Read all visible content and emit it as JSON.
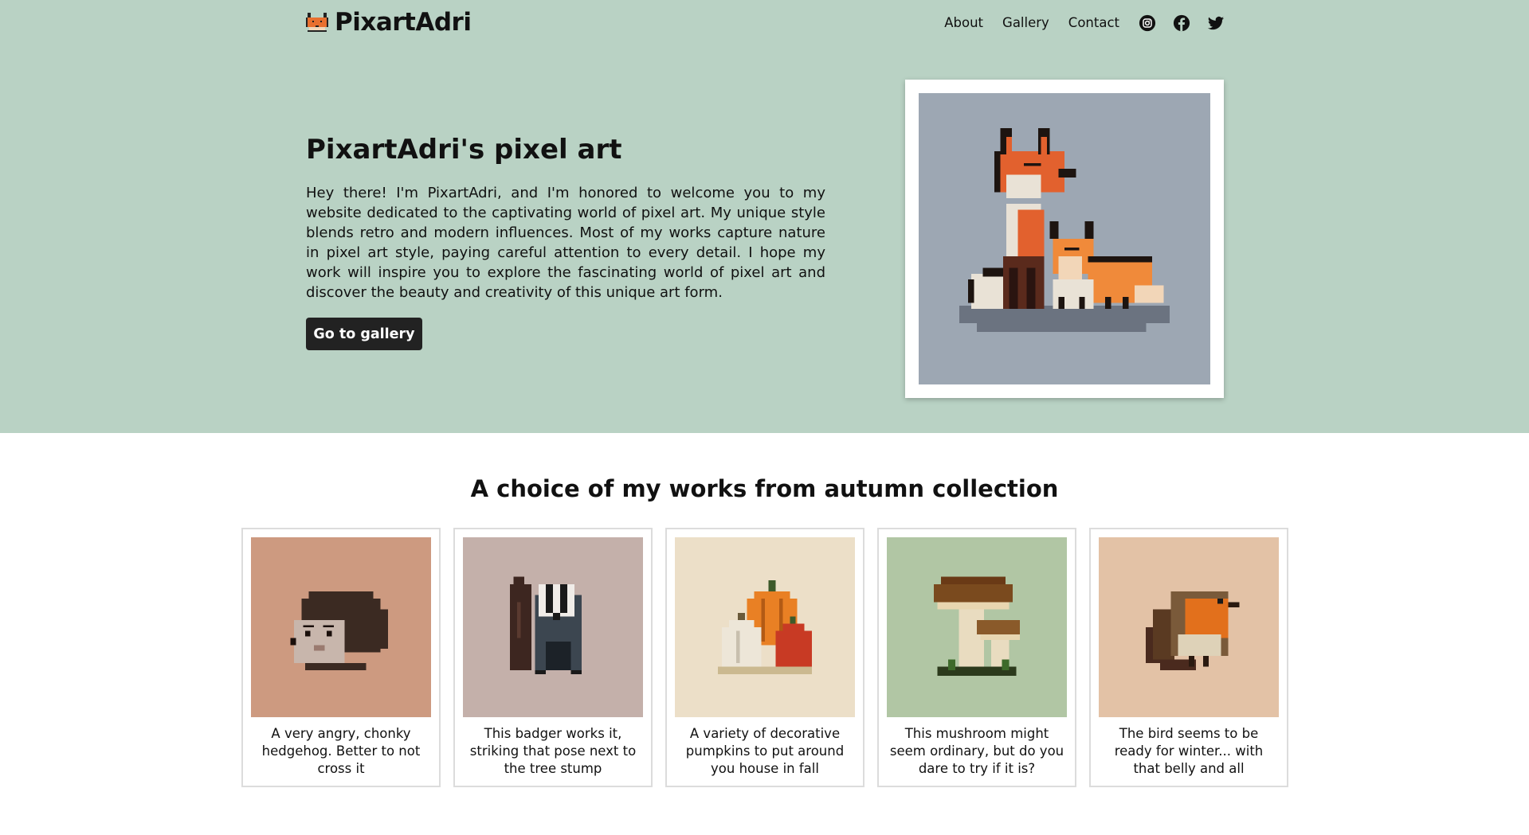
{
  "brand": {
    "name": "PixartAdri",
    "icon": "fox-head-icon"
  },
  "nav": {
    "links": [
      "About",
      "Gallery",
      "Contact"
    ],
    "social_icons": [
      "instagram-icon",
      "facebook-icon",
      "twitter-icon"
    ]
  },
  "hero": {
    "title": "PixartAdri's pixel art",
    "text": "Hey there! I'm PixartAdri, and I'm honored to welcome you to my website dedicated to the captivating world of pixel art. My unique style blends retro and modern influences. Most of my works capture nature in pixel art style, paying careful attention to every detail. I hope my work will inspire you to explore the fascinating world of pixel art and discover the beauty and creativity of this unique art form.",
    "button_label": "Go to gallery",
    "image": "two-foxes-pixel-art"
  },
  "collection": {
    "title": "A choice of my works from autumn collection",
    "cards": [
      {
        "caption": "A very angry, chonky hedgehog. Better to not cross it",
        "image": "hedgehog-pixel-art",
        "bg": "#cd9a80"
      },
      {
        "caption": "This badger works it, striking that pose next to the tree stump",
        "image": "badger-pixel-art",
        "bg": "#c4b0aa"
      },
      {
        "caption": "A variety of decorative pumpkins to put around you house in fall",
        "image": "pumpkins-pixel-art",
        "bg": "#ecdfc8"
      },
      {
        "caption": "This mushroom might seem ordinary, but do you dare to try if it is?",
        "image": "mushrooms-pixel-art",
        "bg": "#b1c6a4"
      },
      {
        "caption": "The bird seems to be ready for winter... with that belly and all",
        "image": "robin-pixel-art",
        "bg": "#e3c2a6"
      }
    ]
  },
  "colors": {
    "hero_bg": "#b9d2c4",
    "button_bg": "#222222",
    "frame_bg": "#9da7b3"
  }
}
